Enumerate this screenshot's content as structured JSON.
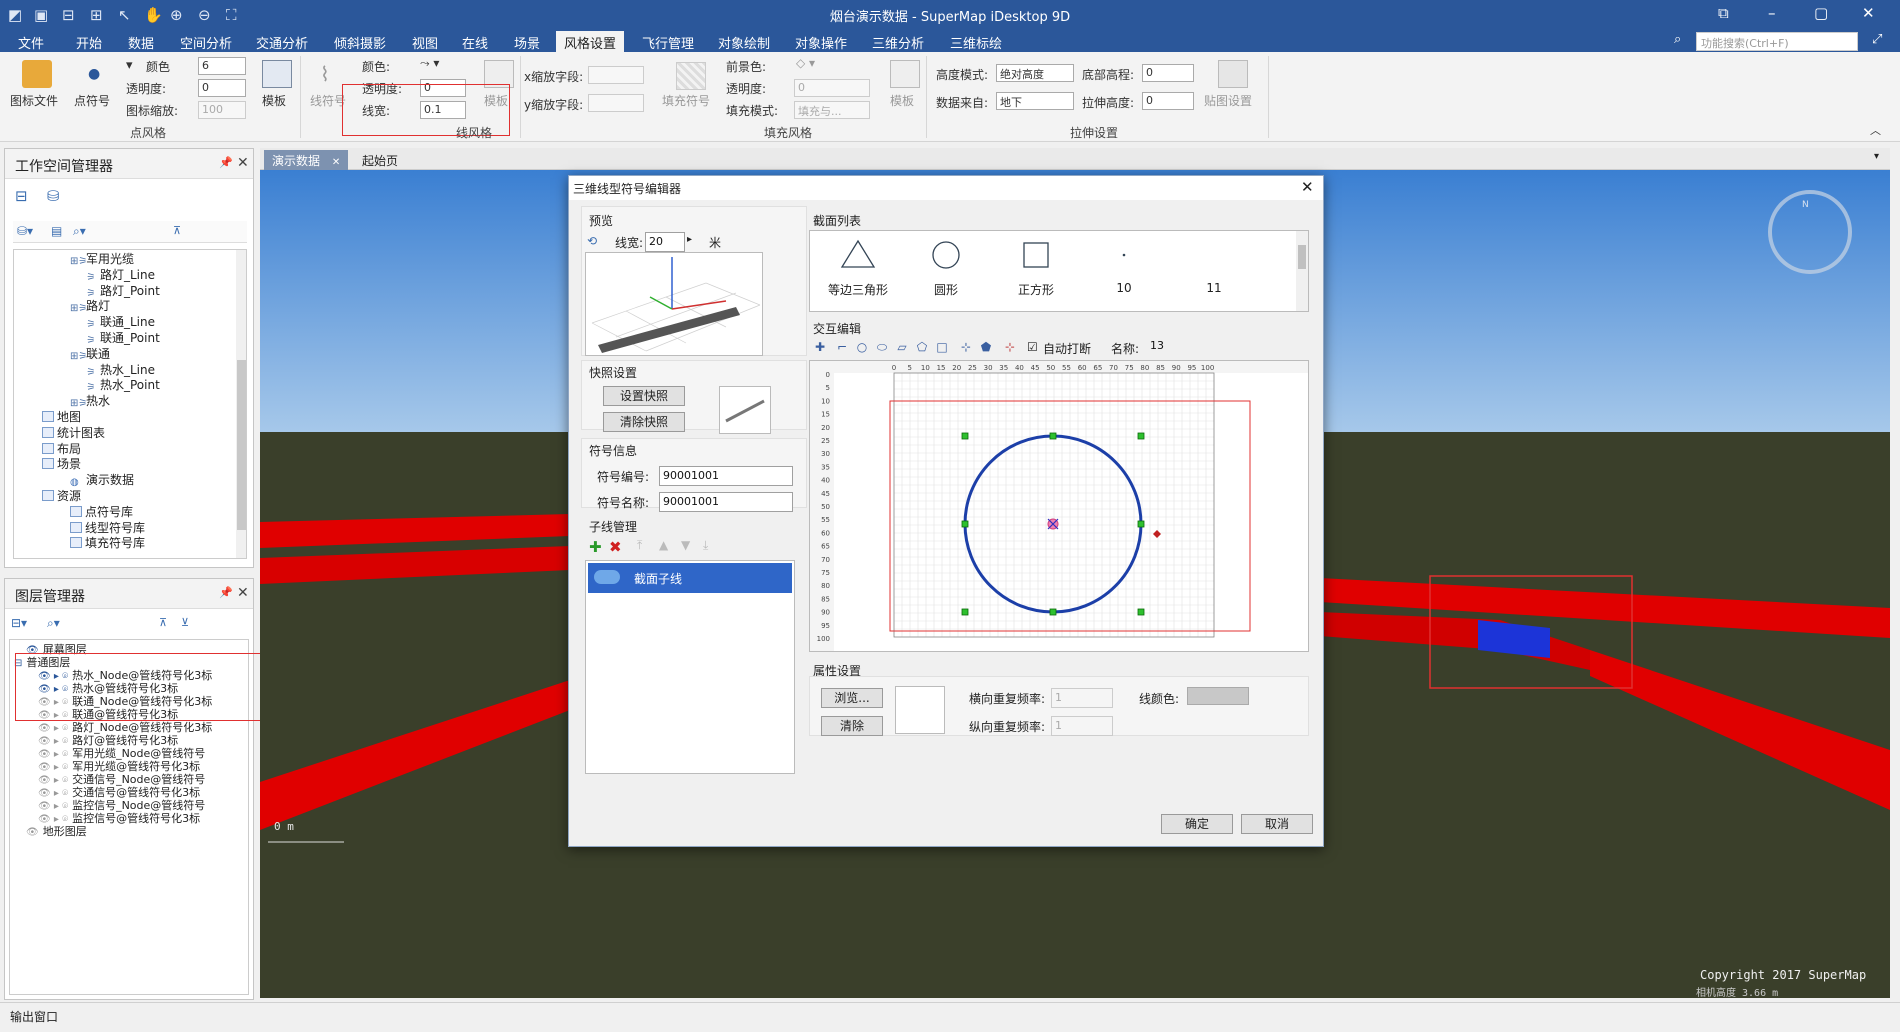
{
  "window": {
    "title": "烟台演示数据 - SuperMap iDesktop 9D"
  },
  "menu": {
    "tabs": [
      "文件",
      "开始",
      "数据",
      "空间分析",
      "交通分析",
      "倾斜摄影",
      "视图",
      "在线",
      "场景",
      "风格设置",
      "飞行管理",
      "对象绘制",
      "对象操作",
      "三维分析",
      "三维标绘"
    ],
    "active": "风格设置",
    "search_placeholder": "功能搜索(Ctrl+F)"
  },
  "ribbon": {
    "point_style": {
      "icon_file": "图标文件",
      "point_symbol": "点符号",
      "template": "模板",
      "color_label": "颜色",
      "color_value": "6",
      "opacity_label": "透明度:",
      "opacity_value": "0",
      "icon_scale_label": "图标缩放:",
      "icon_scale_value": "100",
      "group": "点风格"
    },
    "line_style": {
      "line_symbol": "线符号",
      "template": "模板",
      "color_label": "颜色:",
      "opacity_label": "透明度:",
      "opacity_value": "0",
      "width_label": "线宽:",
      "width_value": "0.1",
      "group": "线风格"
    },
    "fill_style": {
      "x_scale_label": "x缩放字段:",
      "y_scale_label": "y缩放字段:",
      "fill_symbol": "填充符号",
      "template": "模板",
      "fg_color_label": "前景色:",
      "opacity_label": "透明度:",
      "opacity_value": "0",
      "fill_mode_label": "填充模式:",
      "fill_mode_value": "填充与...",
      "group": "填充风格"
    },
    "extrude": {
      "height_mode_label": "高度模式:",
      "height_mode_value": "绝对高度",
      "bottom_elev_label": "底部高程:",
      "bottom_elev_value": "0",
      "data_source_label": "数据来自:",
      "data_source_value": "地下",
      "extrude_height_label": "拉伸高度:",
      "extrude_height_value": "0",
      "texture_label": "贴图设置",
      "group": "拉伸设置"
    }
  },
  "workspace_panel": {
    "title": "工作空间管理器",
    "items": [
      {
        "label": "军用光缆",
        "indent": 4,
        "kind": "grp"
      },
      {
        "label": "路灯_Line",
        "indent": 5,
        "kind": "ln"
      },
      {
        "label": "路灯_Point",
        "indent": 5,
        "kind": "ln"
      },
      {
        "label": "路灯",
        "indent": 4,
        "kind": "grp"
      },
      {
        "label": "联通_Line",
        "indent": 5,
        "kind": "ln"
      },
      {
        "label": "联通_Point",
        "indent": 5,
        "kind": "ln"
      },
      {
        "label": "联通",
        "indent": 4,
        "kind": "grp"
      },
      {
        "label": "热水_Line",
        "indent": 5,
        "kind": "ln"
      },
      {
        "label": "热水_Point",
        "indent": 5,
        "kind": "ln"
      },
      {
        "label": "热水",
        "indent": 4,
        "kind": "grp"
      },
      {
        "label": "地图",
        "indent": 2,
        "kind": "box"
      },
      {
        "label": "统计图表",
        "indent": 2,
        "kind": "box"
      },
      {
        "label": "布局",
        "indent": 2,
        "kind": "box"
      },
      {
        "label": "场景",
        "indent": 2,
        "kind": "box"
      },
      {
        "label": "演示数据",
        "indent": 4,
        "kind": "globe"
      },
      {
        "label": "资源",
        "indent": 2,
        "kind": "box"
      },
      {
        "label": "点符号库",
        "indent": 4,
        "kind": "box"
      },
      {
        "label": "线型符号库",
        "indent": 4,
        "kind": "box"
      },
      {
        "label": "填充符号库",
        "indent": 4,
        "kind": "box"
      }
    ]
  },
  "layer_panel": {
    "title": "图层管理器",
    "items": [
      {
        "label": "屏幕图层",
        "indent": 1
      },
      {
        "label": "普通图层",
        "indent": 0
      },
      {
        "label": "热水_Node@管线符号化3标",
        "indent": 2
      },
      {
        "label": "热水@管线符号化3标",
        "indent": 2
      },
      {
        "label": "联通_Node@管线符号化3标",
        "indent": 2
      },
      {
        "label": "联通@管线符号化3标",
        "indent": 2
      },
      {
        "label": "路灯_Node@管线符号化3标",
        "indent": 2
      },
      {
        "label": "路灯@管线符号化3标",
        "indent": 2
      },
      {
        "label": "军用光缆_Node@管线符号",
        "indent": 2
      },
      {
        "label": "军用光缆@管线符号化3标",
        "indent": 2
      },
      {
        "label": "交通信号_Node@管线符号",
        "indent": 2
      },
      {
        "label": "交通信号@管线符号化3标",
        "indent": 2
      },
      {
        "label": "监控信号_Node@管线符号",
        "indent": 2
      },
      {
        "label": "监控信号@管线符号化3标",
        "indent": 2
      },
      {
        "label": "地形图层",
        "indent": 1
      }
    ]
  },
  "doc_tabs": [
    "演示数据",
    "起始页"
  ],
  "scene": {
    "scale_text": "0 m",
    "copyright": "Copyright 2017 SuperMap",
    "camera_height": "相机高度 3.66 m",
    "compass": "N"
  },
  "status": {
    "output": "输出窗口"
  },
  "dialog": {
    "title": "三维线型符号编辑器",
    "preview": {
      "label": "预览",
      "width_label": "线宽:",
      "width_value": "20",
      "unit": "米"
    },
    "snapshot": {
      "label": "快照设置",
      "set": "设置快照",
      "clear": "清除快照"
    },
    "symbol_info": {
      "label": "符号信息",
      "id_label": "符号编号:",
      "id_value": "90001001",
      "name_label": "符号名称:",
      "name_value": "90001001"
    },
    "subline": {
      "label": "子线管理",
      "item": "截面子线"
    },
    "section_list": {
      "label": "截面列表",
      "items": [
        {
          "label": "等边三角形"
        },
        {
          "label": "圆形"
        },
        {
          "label": "正方形"
        },
        {
          "label": "10"
        },
        {
          "label": "11"
        }
      ]
    },
    "interactive": {
      "label": "交互编辑",
      "auto_break": "自动打断",
      "name_label": "名称:",
      "name_value": "13",
      "ruler_x": [
        "0",
        "5",
        "10",
        "15",
        "20",
        "25",
        "30",
        "35",
        "40",
        "45",
        "50",
        "55",
        "60",
        "65",
        "70",
        "75",
        "80",
        "85",
        "90",
        "95",
        "100"
      ],
      "ruler_y": [
        "0",
        "5",
        "10",
        "15",
        "20",
        "25",
        "30",
        "35",
        "40",
        "45",
        "50",
        "55",
        "60",
        "65",
        "70",
        "75",
        "80",
        "85",
        "90",
        "95",
        "100"
      ]
    },
    "attributes": {
      "label": "属性设置",
      "browse": "浏览...",
      "clear": "清除",
      "h_repeat_label": "横向重复频率:",
      "h_repeat_value": "1",
      "v_repeat_label": "纵向重复频率:",
      "v_repeat_value": "1",
      "line_color_label": "线颜色:"
    },
    "ok": "确定",
    "cancel": "取消"
  },
  "colors": {
    "brand": "#2b579a",
    "pipe": "#e00000",
    "circle": "#1c3fa8",
    "ground": "#3a3f2a",
    "selection": "#e03030"
  }
}
